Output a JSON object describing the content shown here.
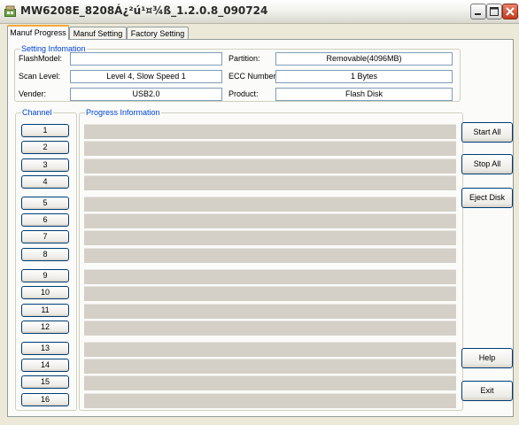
{
  "window": {
    "title": "MW6208E_8208Á¿²ú¹¤¾ß_1.2.0.8_090724",
    "icon": "app-icon"
  },
  "tabs": [
    {
      "label": "Manuf Progress",
      "active": true
    },
    {
      "label": "Manuf Setting",
      "active": false
    },
    {
      "label": "Factory Setting",
      "active": false
    }
  ],
  "settings": {
    "legend": "Setting Infomation",
    "flash_model_label": "FlashModel:",
    "flash_model_value": "",
    "scan_level_label": "Scan Level:",
    "scan_level_value": "Level 4, Slow Speed 1",
    "vender_label": "Vender:",
    "vender_value": "USB2.0",
    "partition_label": "Partition:",
    "partition_value": "Removable(4096MB)",
    "ecc_label": "ECC Number:",
    "ecc_value": "1 Bytes",
    "product_label": "Product:",
    "product_value": "Flash Disk"
  },
  "channel": {
    "legend": "Channel",
    "buttons": [
      "1",
      "2",
      "3",
      "4",
      "5",
      "6",
      "7",
      "8",
      "9",
      "10",
      "11",
      "12",
      "13",
      "14",
      "15",
      "16"
    ]
  },
  "progress": {
    "legend": "Progress Information"
  },
  "actions": {
    "start_all": "Start All",
    "stop_all": "Stop All",
    "eject_disk": "Eject Disk",
    "help": "Help",
    "exit": "Exit"
  }
}
